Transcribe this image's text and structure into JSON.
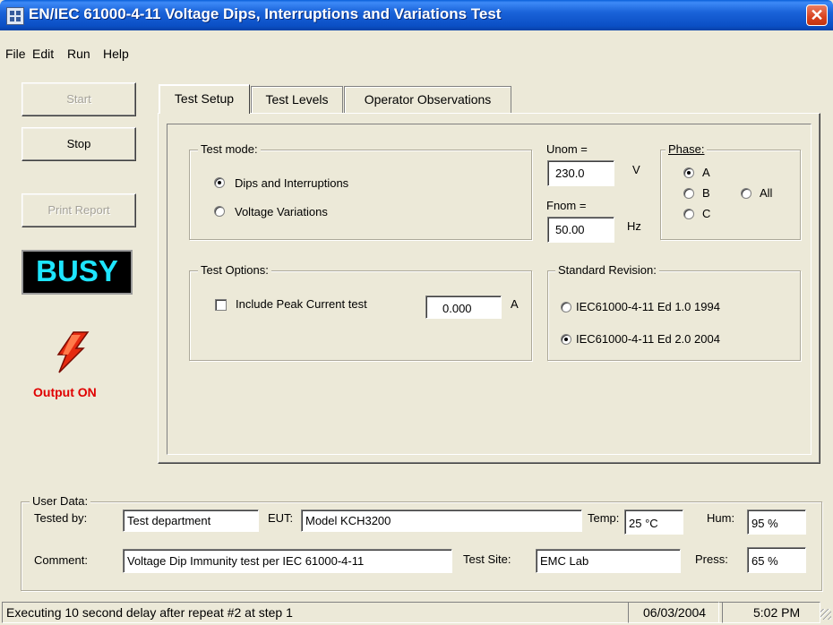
{
  "window": {
    "title": "EN/IEC 61000-4-11 Voltage Dips, Interruptions and Variations Test",
    "close_glyph": "✕"
  },
  "menu": [
    "File",
    "Edit",
    "Run",
    "Help"
  ],
  "sidebar": {
    "start_label": "Start",
    "stop_label": "Stop",
    "print_label": "Print Report",
    "busy_text": "BUSY",
    "output_status": "Output ON",
    "output_icon": "lightning-bolt-icon"
  },
  "tabs": [
    {
      "label": "Test Setup",
      "active": true
    },
    {
      "label": "Test Levels",
      "active": false
    },
    {
      "label": "Operator Observations",
      "active": false
    }
  ],
  "test_mode": {
    "title": "Test mode:",
    "options": [
      {
        "label": "Dips and Interruptions",
        "selected": true
      },
      {
        "label": "Voltage Variations",
        "selected": false
      }
    ]
  },
  "nominal": {
    "unom_label": "Unom =",
    "unom_value": "230.0",
    "unom_unit": "V",
    "fnom_label": "Fnom =",
    "fnom_value": "50.00",
    "fnom_unit": "Hz"
  },
  "phase": {
    "title": "Phase:",
    "options": [
      {
        "label": "A",
        "selected": true
      },
      {
        "label": "B",
        "selected": false
      },
      {
        "label": "C",
        "selected": false
      },
      {
        "label": "All",
        "selected": false
      }
    ]
  },
  "test_options": {
    "title": "Test Options:",
    "peak_current_label": "Include Peak Current test",
    "peak_current_checked": false,
    "peak_current_value": "0.000",
    "peak_current_unit": "A"
  },
  "standard_revision": {
    "title": "Standard Revision:",
    "options": [
      {
        "label": "IEC61000-4-11 Ed 1.0 1994",
        "selected": false
      },
      {
        "label": "IEC61000-4-11 Ed 2.0 2004",
        "selected": true
      }
    ]
  },
  "user_data": {
    "title": "User Data:",
    "tested_by_label": "Tested by:",
    "tested_by_value": "Test department",
    "eut_label": "EUT:",
    "eut_value": "Model KCH3200",
    "temp_label": "Temp:",
    "temp_value": "25 °C",
    "hum_label": "Hum:",
    "hum_value": "95 %",
    "comment_label": "Comment:",
    "comment_value": "Voltage Dip Immunity test per IEC 61000-4-11",
    "site_label": "Test Site:",
    "site_value": "EMC Lab",
    "press_label": "Press:",
    "press_value": "65 %"
  },
  "status_bar": {
    "message": "Executing 10 second delay after repeat #2 at step 1",
    "date": "06/03/2004",
    "time": "5:02 PM"
  },
  "colors": {
    "titlebar": "#0b4fc5",
    "busy_text": "#1ee5ff",
    "output_on": "#e00000",
    "bolt": "#e52a10"
  }
}
